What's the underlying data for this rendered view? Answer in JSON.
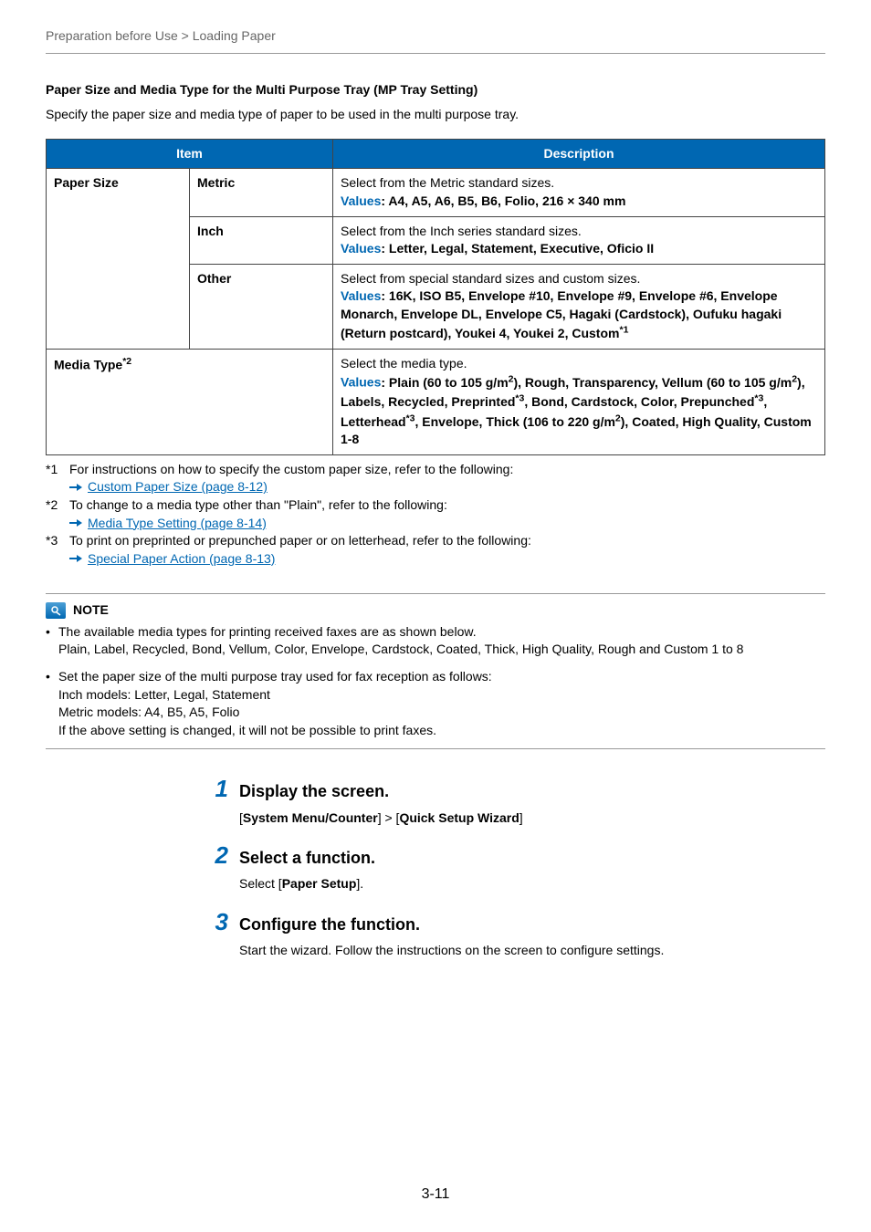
{
  "breadcrumb": "Preparation before Use > Loading Paper",
  "section": {
    "heading": "Paper Size and Media Type for the Multi Purpose Tray (MP Tray Setting)",
    "intro": "Specify the paper size and media type of paper to be used in the multi purpose tray."
  },
  "table": {
    "headers": {
      "item": "Item",
      "description": "Description"
    },
    "rows": {
      "paperSize": {
        "label": "Paper Size",
        "metric": {
          "label": "Metric",
          "desc": "Select from the Metric standard sizes.",
          "values": ": A4, A5, A6, B5, B6, Folio, 216 × 340 mm"
        },
        "inch": {
          "label": "Inch",
          "desc": "Select from the Inch series standard sizes.",
          "values": ": Letter, Legal, Statement, Executive, Oficio II"
        },
        "other": {
          "label": "Other",
          "desc": "Select from special standard sizes and custom sizes.",
          "values_line1": ": 16K, ISO B5, Envelope #10, Envelope #9, Envelope #6, Envelope Monarch, Envelope DL, Envelope C5, Hagaki (Cardstock), Oufuku hagaki (Return postcard), Youkei 4, Youkei 2, Custom",
          "sup": "*1"
        }
      },
      "mediaType": {
        "label": "Media Type",
        "sup": "*2",
        "desc": "Select the media type.",
        "values_p1": ": Plain (60 to 105 g/m",
        "values_p2": "), Rough, Transparency, Vellum (60 to 105 g/m",
        "values_p3": "), Labels, Recycled, Preprinted",
        "values_p4": ", Bond, Cardstock, Color, Prepunched",
        "values_p5": ", Letterhead",
        "values_p6": ", Envelope, Thick (106 to 220 g/m",
        "values_p7": "), Coated, High Quality, Custom 1-8",
        "s2": "2",
        "s3": "*3"
      }
    },
    "valuesLabel": "Values"
  },
  "footnotes": {
    "fn1": {
      "label": "*1",
      "text": "For instructions on how to specify the custom paper size, refer to the following:",
      "link": "Custom Paper Size (page 8-12)"
    },
    "fn2": {
      "label": "*2",
      "text": "To change to a media type other than \"Plain\", refer to the following:",
      "link": "Media Type Setting (page 8-14)"
    },
    "fn3": {
      "label": "*3",
      "text": "To print on preprinted or prepunched paper or on letterhead, refer to the following:",
      "link": "Special Paper Action (page 8-13)"
    }
  },
  "note": {
    "label": "NOTE",
    "b1_line1": "The available media types for printing received faxes are as shown below.",
    "b1_line2": "Plain, Label, Recycled, Bond, Vellum, Color, Envelope, Cardstock, Coated, Thick, High Quality, Rough and Custom 1 to 8",
    "b2_line1": "Set the paper size of the multi purpose tray used for fax reception as follows:",
    "b2_line2": "Inch models: Letter, Legal, Statement",
    "b2_line3": "Metric models: A4, B5, A5, Folio",
    "b2_line4": "If the above setting is changed, it will not be possible to print faxes."
  },
  "steps": {
    "s1": {
      "num": "1",
      "title": "Display the screen.",
      "body_open": "[",
      "body_bold1": "System Menu/Counter",
      "body_mid": "] > [",
      "body_bold2": "Quick Setup Wizard",
      "body_close": "]"
    },
    "s2": {
      "num": "2",
      "title": "Select a function.",
      "body_pre": "Select [",
      "body_bold": "Paper Setup",
      "body_post": "]."
    },
    "s3": {
      "num": "3",
      "title": "Configure the function.",
      "body": "Start the wizard. Follow the instructions on the screen to configure settings."
    }
  },
  "pageNumber": "3-11"
}
